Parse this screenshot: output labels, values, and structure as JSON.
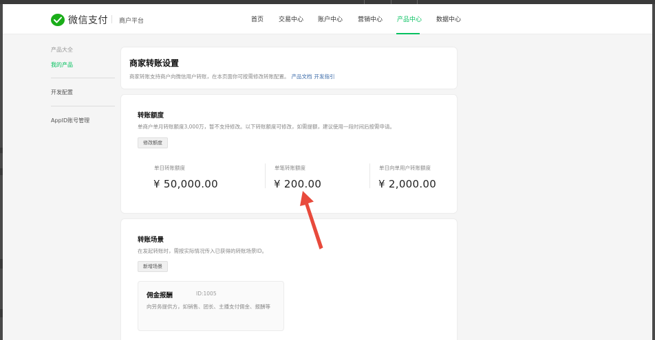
{
  "header": {
    "brand": "微信支付",
    "platform": "商户平台",
    "nav": [
      {
        "label": "首页"
      },
      {
        "label": "交易中心"
      },
      {
        "label": "账户中心"
      },
      {
        "label": "营销中心"
      },
      {
        "label": "产品中心"
      },
      {
        "label": "数据中心"
      }
    ],
    "active_nav": "产品中心"
  },
  "sidebar": {
    "section": "产品大全",
    "items": [
      {
        "label": "我的产品"
      },
      {
        "label": "开发配置"
      },
      {
        "label": "AppID账号管理"
      }
    ]
  },
  "intro": {
    "title": "商家转账设置",
    "desc": "商家转账支持商户向微信用户转账，在本页面你可按需修改转账配置。",
    "links": [
      "产品文档",
      "开发指引"
    ]
  },
  "limits": {
    "title": "转账额度",
    "desc": "单商户单月转账额度3,000万，暂不支持修改。以下转账额度可修改，如需提额，建议使用一段时间后按需申请。",
    "button": "修改额度",
    "stats": [
      {
        "label": "单日转账额度",
        "value": "¥ 50,000.00"
      },
      {
        "label": "单笔转账额度",
        "value": "¥ 200.00"
      },
      {
        "label": "单日向单用户转账额度",
        "value": "¥ 2,000.00"
      }
    ]
  },
  "scenes": {
    "title": "转账场景",
    "desc": "在发起转账时，需按实际情况传入已获得的转账场景ID。",
    "button": "新增场景",
    "items": [
      {
        "name": "佣金报酬",
        "id": "ID:1005",
        "desc": "向劳务提供方，如销售、团长、主播支付佣金、报酬等"
      }
    ]
  },
  "colors": {
    "accent": "#07c160",
    "annotation": "#e84a3c"
  }
}
